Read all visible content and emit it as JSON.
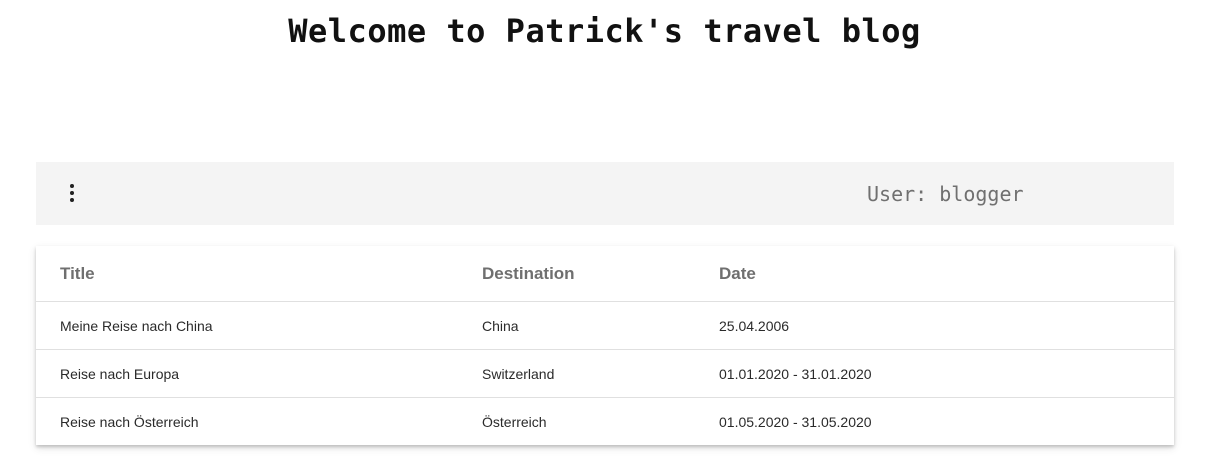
{
  "header": {
    "title": "Welcome to Patrick's travel blog"
  },
  "toolbar": {
    "menu_icon": "more-vertical-icon",
    "user_label": "User: blogger"
  },
  "table": {
    "columns": [
      "Title",
      "Destination",
      "Date"
    ],
    "rows": [
      [
        "Meine Reise nach China",
        "China",
        "25.04.2006"
      ],
      [
        "Reise nach Europa",
        "Switzerland",
        "01.01.2020 - 31.01.2020"
      ],
      [
        "Reise nach Österreich",
        "Österreich",
        "01.05.2020 - 31.05.2020"
      ]
    ]
  },
  "colors": {
    "toolbar_bg": "#f4f4f4",
    "header_text": "#6f6f6f",
    "user_text": "#707070"
  }
}
